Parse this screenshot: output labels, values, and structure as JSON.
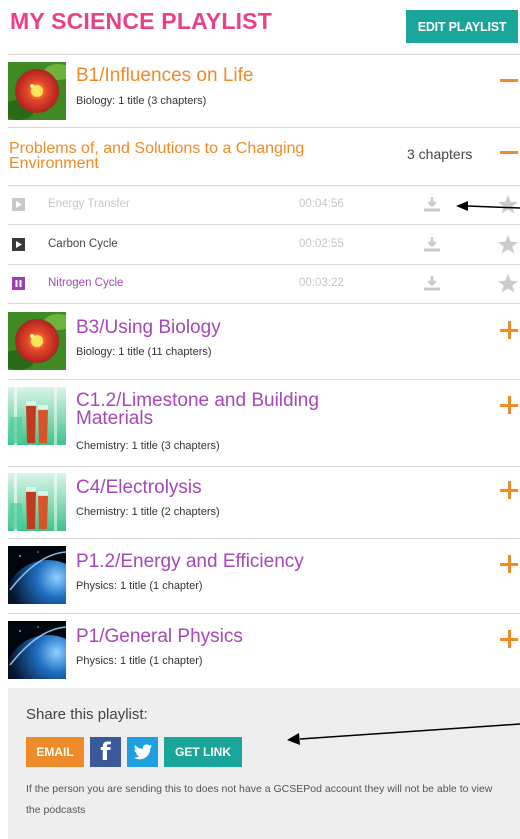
{
  "header": {
    "title": "MY SCIENCE PLAYLIST",
    "edit_label": "EDIT PLAYLIST"
  },
  "courses": [
    {
      "title": "B1/Influences on Life",
      "subtitle": "Biology: 1 title (3 chapters)",
      "thumbnail": "flower-image",
      "toggle": "minus",
      "color": "#ef8a28"
    },
    {
      "title": "B3/Using Biology",
      "subtitle": "Biology: 1 title (11 chapters)",
      "thumbnail": "flower-image",
      "toggle": "plus",
      "color": "#a447b8"
    },
    {
      "title": "C1.2/Limestone and Building Materials",
      "subtitle": "Chemistry: 1 title (3 chapters)",
      "thumbnail": "test-tubes-image",
      "toggle": "plus",
      "color": "#a447b8"
    },
    {
      "title": "C4/Electrolysis",
      "subtitle": "Chemistry: 1 title (2 chapters)",
      "thumbnail": "test-tubes-image",
      "toggle": "plus",
      "color": "#a447b8"
    },
    {
      "title": "P1.2/Energy and Efficiency",
      "subtitle": "Physics: 1 title (1 chapter)",
      "thumbnail": "planet-image",
      "toggle": "plus",
      "color": "#a447b8"
    },
    {
      "title": "P1/General Physics",
      "subtitle": "Physics: 1 title (1 chapter)",
      "thumbnail": "planet-image",
      "toggle": "plus",
      "color": "#a447b8"
    }
  ],
  "chapter": {
    "title": "Problems of, and Solutions to a Changing Environment",
    "count": "3 chapters",
    "toggle": "minus"
  },
  "episodes": [
    {
      "name": "Energy Transfer",
      "duration": "00:04:56",
      "state": "disabled",
      "icon": "play-icon"
    },
    {
      "name": "Carbon Cycle",
      "duration": "00:02:55",
      "state": "normal",
      "icon": "play-icon"
    },
    {
      "name": "Nitrogen Cycle",
      "duration": "00:03:22",
      "state": "playing",
      "icon": "pause-icon"
    }
  ],
  "share": {
    "title": "Share this playlist:",
    "email_label": "EMAIL",
    "facebook_icon": "f",
    "twitter_icon": "twitter-bird-icon",
    "getlink_label": "GET LINK",
    "note": "If the person you are sending this to does not have a GCSEPod account they will not be able to view the podcasts"
  },
  "colors": {
    "pink": "#e8418a",
    "teal": "#1aa59a",
    "orange": "#ef8a28",
    "purple": "#a447b8",
    "facebook": "#3b5998",
    "twitter": "#1e9fe0"
  }
}
